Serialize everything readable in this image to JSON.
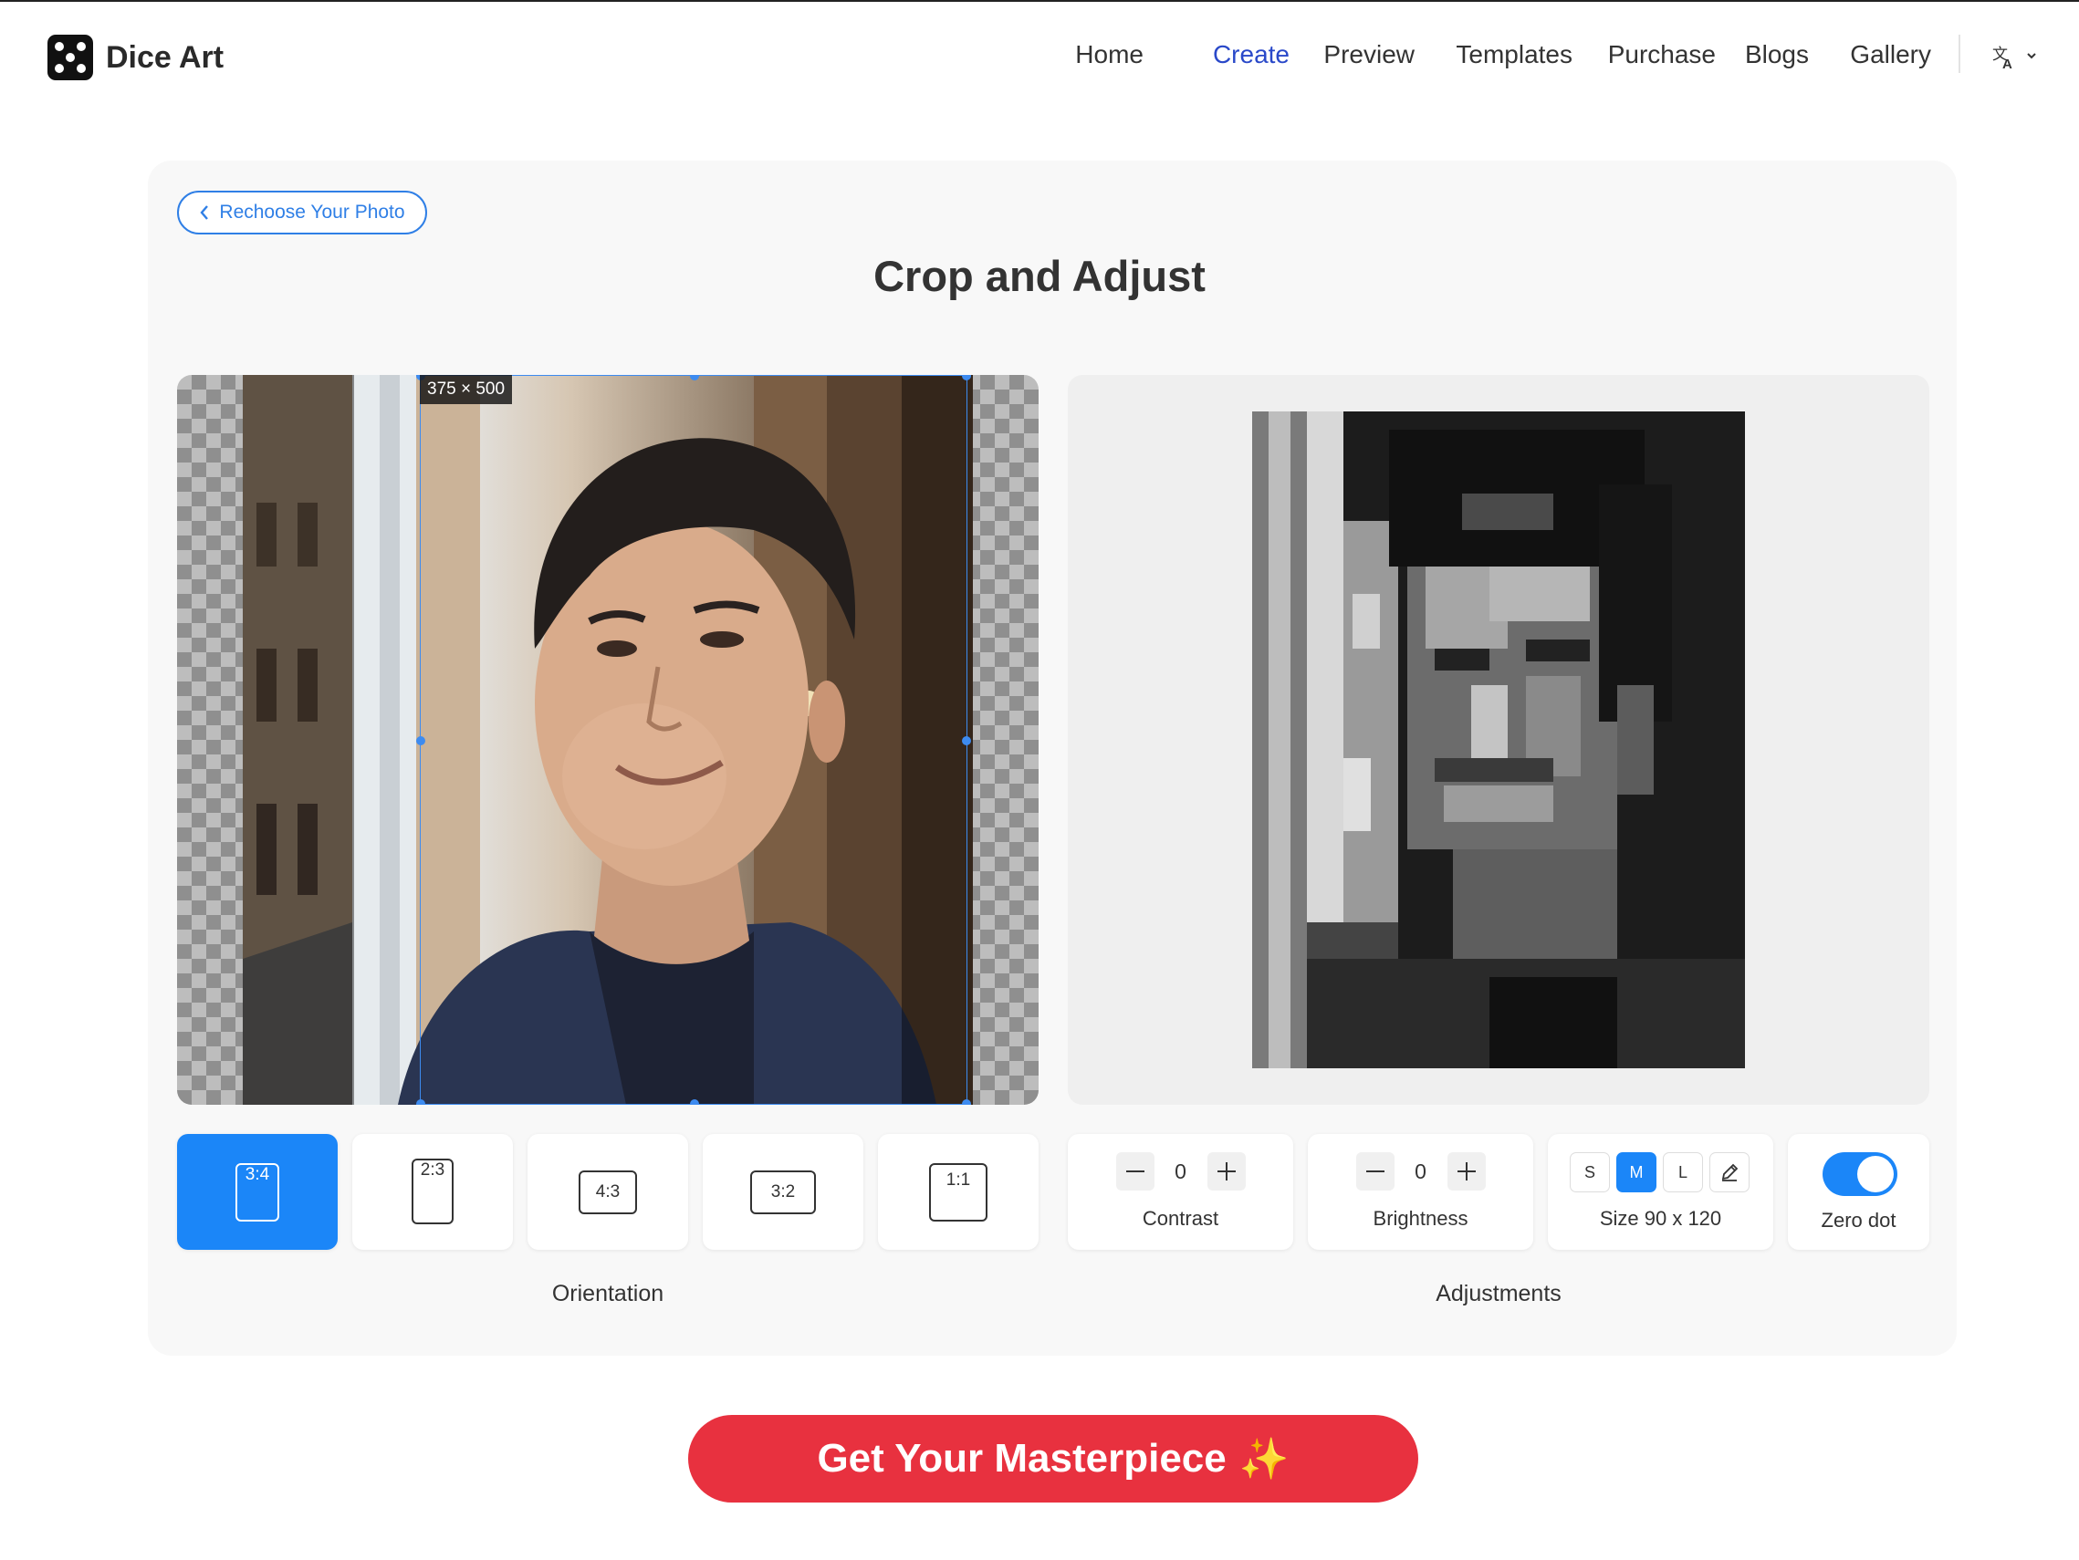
{
  "brand": {
    "name": "Dice Art"
  },
  "nav": {
    "items": [
      {
        "label": "Home"
      },
      {
        "label": "Create"
      },
      {
        "label": "Preview"
      },
      {
        "label": "Templates"
      },
      {
        "label": "Purchase"
      },
      {
        "label": "Blogs"
      },
      {
        "label": "Gallery"
      }
    ],
    "active": "Create",
    "language_icon": "translate-icon"
  },
  "back_button": {
    "label": "Rechoose Your Photo"
  },
  "page_title": "Crop and Adjust",
  "crop": {
    "dimensions": "375 × 500"
  },
  "orientation": {
    "label": "Orientation",
    "options": [
      {
        "ratio": "3:4",
        "selected": true
      },
      {
        "ratio": "2:3",
        "selected": false
      },
      {
        "ratio": "4:3",
        "selected": false
      },
      {
        "ratio": "3:2",
        "selected": false
      },
      {
        "ratio": "1:1",
        "selected": false
      }
    ]
  },
  "adjustments": {
    "label": "Adjustments",
    "contrast": {
      "label": "Contrast",
      "value": "0"
    },
    "brightness": {
      "label": "Brightness",
      "value": "0"
    },
    "size": {
      "options": [
        "S",
        "M",
        "L"
      ],
      "selected": "M",
      "label": "Size 90 x 120"
    },
    "zero_dot": {
      "label": "Zero dot",
      "enabled": true
    }
  },
  "cta": {
    "label": "Get Your Masterpiece",
    "emoji": "✨"
  },
  "colors": {
    "accent": "#1b86f8",
    "nav_active": "#2a49c9",
    "cta": "#e8313f"
  }
}
